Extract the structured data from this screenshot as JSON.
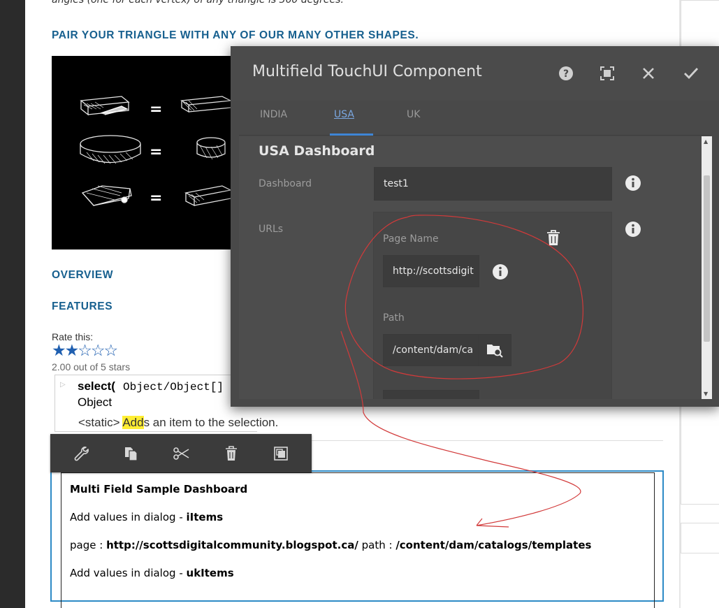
{
  "page": {
    "cut_text": "angles (one for each vertex) of any triangle is 360 degrees.",
    "heading_pair": "PAIR YOUR TRIANGLE WITH ANY OF OUR MANY OTHER SHAPES.",
    "equals": [
      "=",
      "=",
      "="
    ],
    "heading_overview": "OVERVIEW",
    "heading_features": "FEATURES",
    "rate_label": "Rate this:",
    "stars_display": "★★☆☆☆",
    "rating_value": 2,
    "rating_max": 5,
    "rating_text": "2.00 out of 5 stars",
    "code_select": "select(",
    "code_signature": "Object/Object[] ",
    "code_return_type": "Object",
    "code_desc_prefix": "<static> ",
    "code_desc_highlight": "Add",
    "code_desc_rest": "s an item to the selection."
  },
  "toolbar": {
    "icons": [
      "wrench-icon",
      "copy-icon",
      "cut-icon",
      "delete-icon",
      "group-icon"
    ]
  },
  "component": {
    "title": "Multi Field Sample Dashboard",
    "line1_prefix": "Add values in dialog - ",
    "line1_bold": "iItems",
    "line2_page_label": "page : ",
    "line2_page_value": "http://scottsdigitalcommunity.blogspot.ca/",
    "line2_path_label": " path : ",
    "line2_path_value": "/content/dam/catalogs/templates",
    "line3_prefix": "Add values in dialog - ",
    "line3_bold": "ukItems"
  },
  "dialog": {
    "title": "Multifield TouchUI Component",
    "tabs": [
      {
        "label": "INDIA",
        "active": false
      },
      {
        "label": "USA",
        "active": true
      },
      {
        "label": "UK",
        "active": false
      }
    ],
    "section_title": "USA Dashboard",
    "dashboard_label": "Dashboard",
    "dashboard_value": "test1",
    "urls_label": "URLs",
    "page_name_label": "Page Name",
    "page_name_value": "http://scottsdigit",
    "path_label": "Path",
    "path_value": "/content/dam/ca",
    "header_icons": [
      "help-icon",
      "fullscreen-icon",
      "close-icon",
      "check-icon"
    ]
  },
  "colors": {
    "heading_blue": "#17608f",
    "dialog_bg": "#494949",
    "tab_active": "#3e85d6",
    "annotation_red": "#d23a3a",
    "component_outline": "#2d8ac6"
  }
}
